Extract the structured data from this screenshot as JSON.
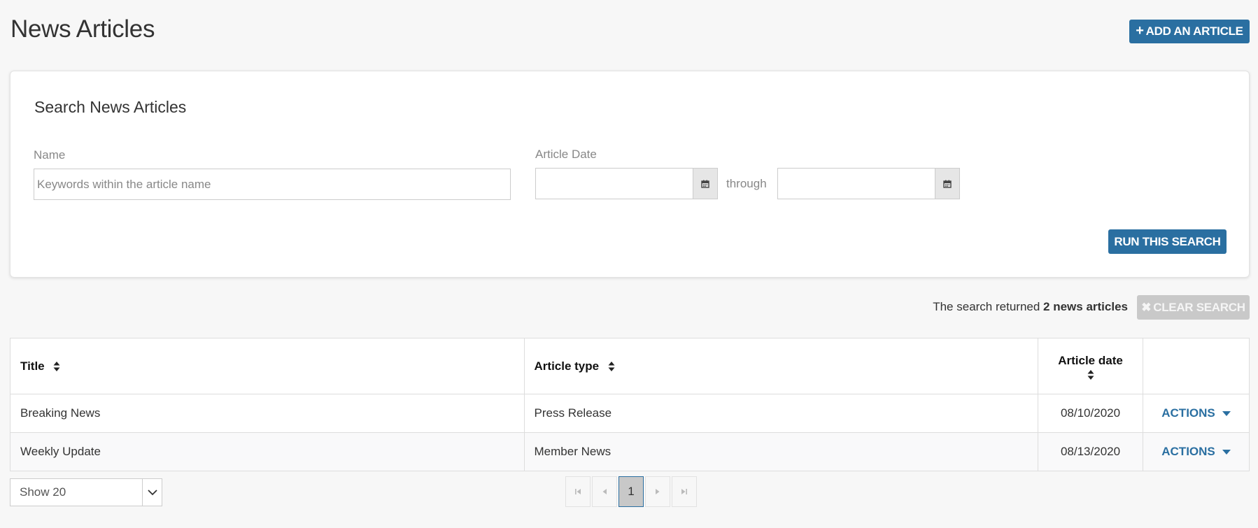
{
  "header": {
    "title": "News Articles",
    "add_label": "ADD AN ARTICLE"
  },
  "search": {
    "title": "Search News Articles",
    "name_label": "Name",
    "name_placeholder": "Keywords within the article name",
    "name_value": "",
    "date_label": "Article Date",
    "date_from": "",
    "through_label": "through",
    "date_to": "",
    "run_label": "RUN THIS SEARCH"
  },
  "results": {
    "prefix": "The search returned ",
    "count_text": "2 news articles",
    "clear_label": "CLEAR SEARCH"
  },
  "table": {
    "headers": {
      "title": "Title",
      "type": "Article type",
      "date": "Article date"
    },
    "rows": [
      {
        "title": "Breaking News",
        "type": "Press Release",
        "date": "08/10/2020",
        "action": "ACTIONS"
      },
      {
        "title": "Weekly Update",
        "type": "Member News",
        "date": "08/13/2020",
        "action": "ACTIONS"
      }
    ]
  },
  "pagination": {
    "page_size": "Show 20",
    "current_page": "1"
  },
  "colors": {
    "accent": "#2a6fa1",
    "disabled": "#c9c9c9",
    "background": "#f7f7f7"
  },
  "icons": [
    "plus-icon",
    "calendar-icon",
    "close-icon",
    "sort-icon",
    "caret-down-icon",
    "chevron-down-icon",
    "first-page-icon",
    "prev-page-icon",
    "next-page-icon",
    "last-page-icon"
  ]
}
